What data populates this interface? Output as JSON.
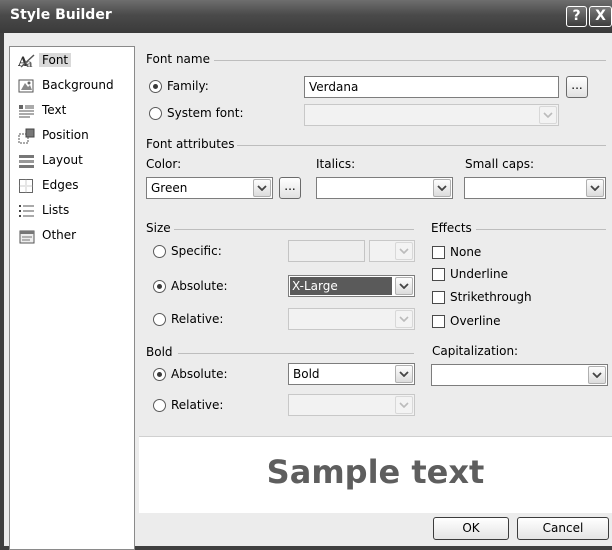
{
  "window": {
    "title": "Style Builder",
    "help_label": "?",
    "close_label": "X"
  },
  "sidebar": {
    "items": [
      {
        "label": "Font",
        "icon": "font-icon",
        "selected": true
      },
      {
        "label": "Background",
        "icon": "background-icon"
      },
      {
        "label": "Text",
        "icon": "text-icon"
      },
      {
        "label": "Position",
        "icon": "position-icon"
      },
      {
        "label": "Layout",
        "icon": "layout-icon"
      },
      {
        "label": "Edges",
        "icon": "edges-icon"
      },
      {
        "label": "Lists",
        "icon": "lists-icon"
      },
      {
        "label": "Other",
        "icon": "other-icon"
      }
    ]
  },
  "font_name": {
    "section": "Font name",
    "family_label": "Family:",
    "family_value": "Verdana",
    "system_font_label": "System font:",
    "system_font_value": "",
    "ellipsis": "..."
  },
  "font_attributes": {
    "section": "Font attributes",
    "color_label": "Color:",
    "color_value": "Green",
    "italics_label": "Italics:",
    "italics_value": "",
    "small_caps_label": "Small caps:",
    "small_caps_value": "",
    "ellipsis": "..."
  },
  "size": {
    "section": "Size",
    "specific_label": "Specific:",
    "absolute_label": "Absolute:",
    "absolute_value": "X-Large",
    "relative_label": "Relative:",
    "relative_value": ""
  },
  "effects": {
    "section": "Effects",
    "none": "None",
    "underline": "Underline",
    "strikethrough": "Strikethrough",
    "overline": "Overline"
  },
  "bold": {
    "section": "Bold",
    "absolute_label": "Absolute:",
    "absolute_value": "Bold",
    "relative_label": "Relative:",
    "relative_value": ""
  },
  "capitalization": {
    "label": "Capitalization:",
    "value": ""
  },
  "preview": {
    "sample_text": "Sample text"
  },
  "buttons": {
    "ok": "OK",
    "cancel": "Cancel"
  },
  "colors": {
    "titlebar": "#4a4a4a",
    "highlight": "#5a5a5a",
    "sample_text": "#5e5e5e"
  }
}
